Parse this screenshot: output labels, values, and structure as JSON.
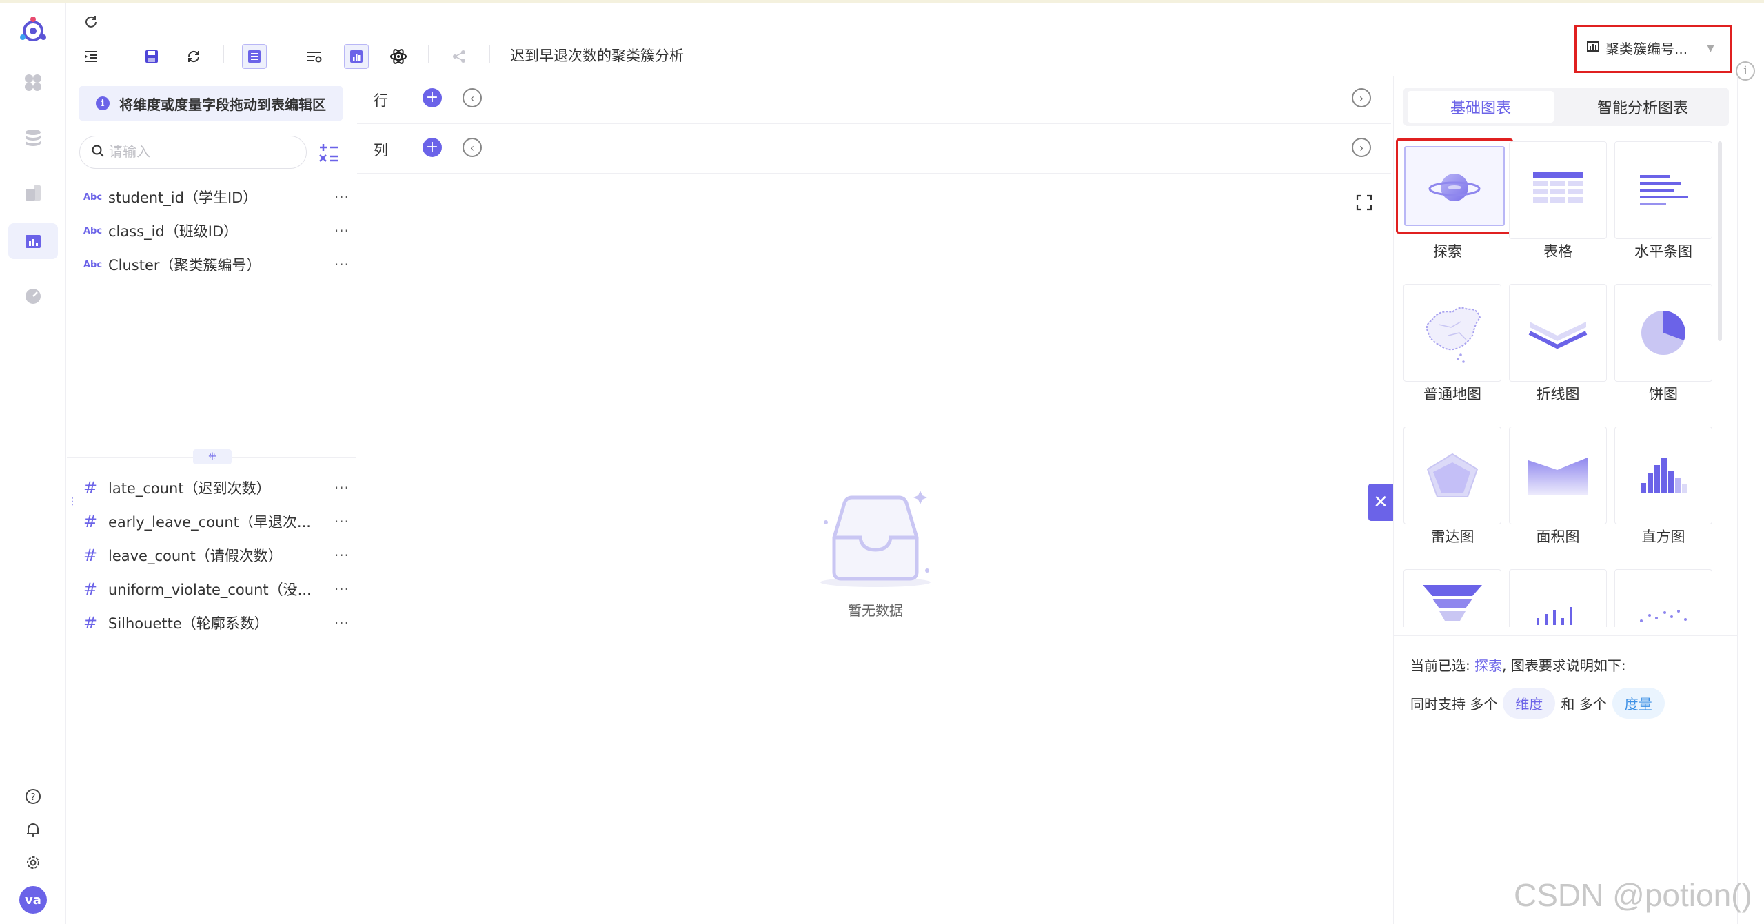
{
  "colors": {
    "accent": "#6b63e8",
    "highlight_box": "#e02020",
    "accent_light": "#eef0fc"
  },
  "toolbar": {
    "refresh_icon": "refresh-icon",
    "document_title": "迟到早退次数的聚类簇分析",
    "chart_selector_label": "聚类簇编号..."
  },
  "field_panel": {
    "hint": "将维度或度量字段拖动到表编辑区",
    "search_placeholder": "请输入",
    "dimensions": [
      {
        "type": "Abc",
        "label": "student_id（学生ID）"
      },
      {
        "type": "Abc",
        "label": "class_id（班级ID）"
      },
      {
        "type": "Abc",
        "label": "Cluster（聚类簇编号）"
      }
    ],
    "measures": [
      {
        "type": "#",
        "label": "late_count（迟到次数）"
      },
      {
        "type": "#",
        "label": "early_leave_count（早退次..."
      },
      {
        "type": "#",
        "label": "leave_count（请假次数）"
      },
      {
        "type": "#",
        "label": "uniform_violate_count（没..."
      },
      {
        "type": "#",
        "label": "Silhouette（轮廓系数）"
      }
    ],
    "more": "···"
  },
  "canvas": {
    "row_label": "行",
    "column_label": "列",
    "empty_text": "暂无数据"
  },
  "chart_panel": {
    "tabs": [
      "基础图表",
      "智能分析图表"
    ],
    "active_tab": 0,
    "charts": [
      {
        "label": "探索",
        "icon": "planet-icon"
      },
      {
        "label": "表格",
        "icon": "table-icon"
      },
      {
        "label": "水平条图",
        "icon": "horizontal-bar-icon"
      },
      {
        "label": "普通地图",
        "icon": "map-icon"
      },
      {
        "label": "折线图",
        "icon": "line-chart-icon"
      },
      {
        "label": "饼图",
        "icon": "pie-chart-icon"
      },
      {
        "label": "雷达图",
        "icon": "radar-chart-icon"
      },
      {
        "label": "面积图",
        "icon": "area-chart-icon"
      },
      {
        "label": "直方图",
        "icon": "histogram-icon"
      }
    ],
    "selected_chart": "探索",
    "requirement_prefix": "当前已选:",
    "requirement_suffix": ", 图表要求说明如下:",
    "support_prefix": "同时支持 多个",
    "dimension_pill": "维度",
    "support_middle": "和 多个",
    "measure_pill": "度量"
  },
  "user": {
    "avatar_initials": "va"
  },
  "watermark": "CSDN @potion()"
}
